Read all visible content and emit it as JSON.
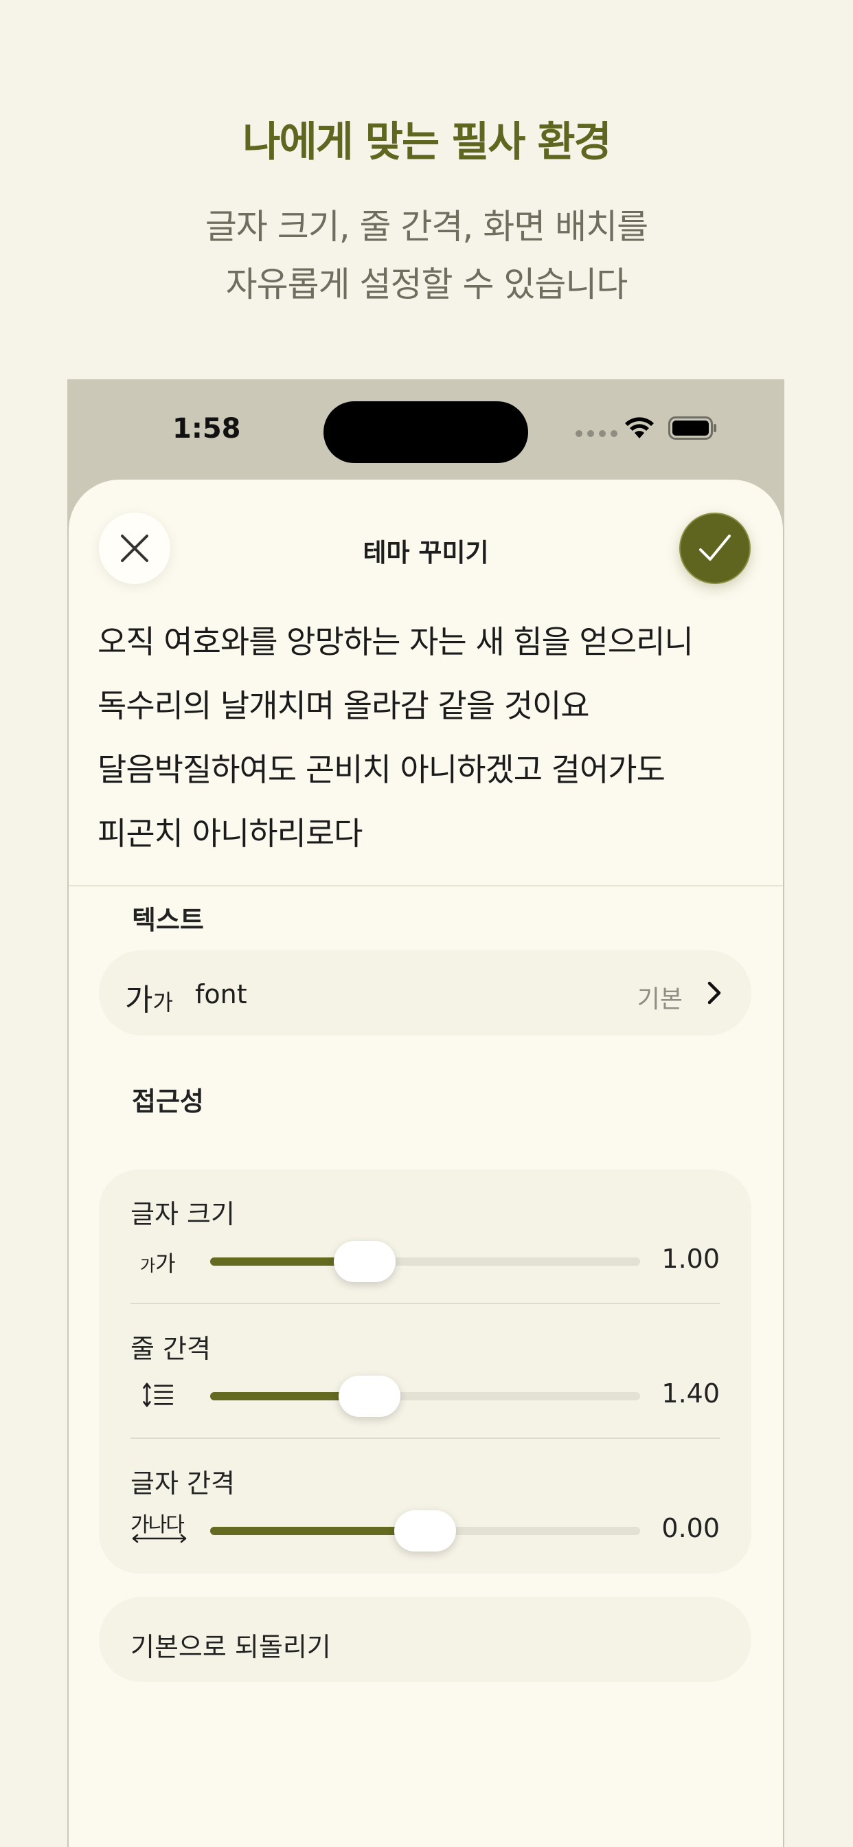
{
  "promo": {
    "title": "나에게 맞는 필사 환경",
    "subtitle_line1": "글자 크기, 줄 간격, 화면 배치를",
    "subtitle_line2": "자유롭게 설정할 수 있습니다"
  },
  "status_bar": {
    "time": "1:58"
  },
  "sheet": {
    "title": "테마 꾸미기",
    "preview_lines": [
      "오직 여호와를 앙망하는 자는 새 힘을 얻으리니",
      "독수리의 날개치며 올라감 같을 것이요",
      "달음박질하여도 곤비치 아니하겠고 걸어가도",
      "피곤치 아니하리로다"
    ]
  },
  "text_section": {
    "label": "텍스트",
    "font_glyph": "가",
    "font_glyph_small": "가",
    "font_name": "font",
    "font_value": "기본"
  },
  "accessibility": {
    "label": "접근성",
    "sliders": [
      {
        "label": "글자 크기",
        "icon": "font-size-icon",
        "icon_text": "가가",
        "value_text": "1.00",
        "fraction": 0.36
      },
      {
        "label": "줄 간격",
        "icon": "line-spacing-icon",
        "icon_text": "",
        "value_text": "1.40",
        "fraction": 0.37
      },
      {
        "label": "글자 간격",
        "icon": "letter-spacing-icon",
        "icon_text": "가나다",
        "value_text": "0.00",
        "fraction": 0.5
      }
    ]
  },
  "reset": {
    "label": "기본으로 되돌리기"
  },
  "colors": {
    "accent": "#5f641e",
    "background": "#f6f3e8",
    "sheet": "#fcfaee"
  }
}
